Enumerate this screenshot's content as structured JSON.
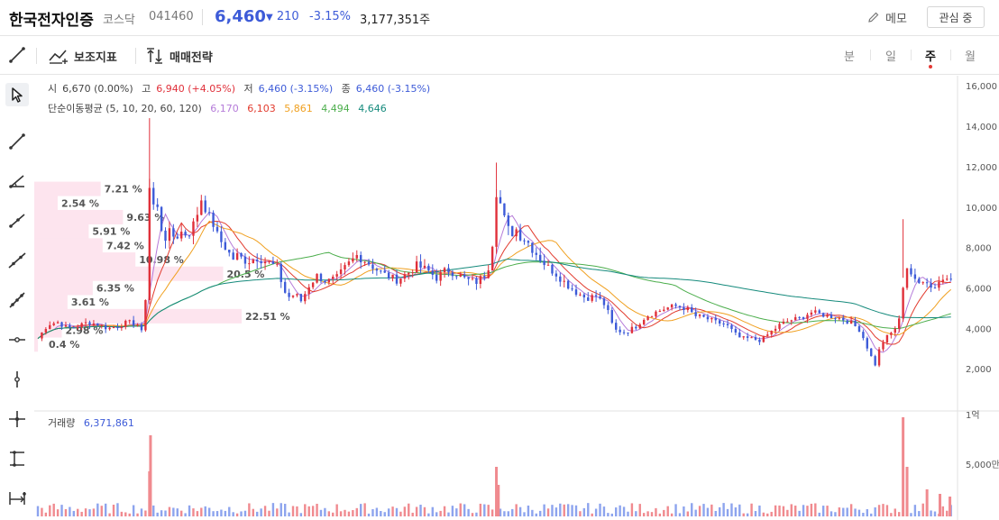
{
  "header": {
    "stock_name": "한국전자인증",
    "market": "코스닥",
    "code": "041460",
    "price": "6,460",
    "change": "210",
    "change_rate": "-3.15%",
    "volume": "3,177,351주",
    "memo_label": "메모",
    "favorite_label": "관심 중"
  },
  "toolbar": {
    "indicator_label": "보조지표",
    "strategy_label": "매매전략",
    "periods": [
      "분",
      "일",
      "주",
      "월"
    ],
    "active_period": "주"
  },
  "left_tools": [
    "cursor-icon",
    "line-icon",
    "angle-line-icon",
    "ray-icon",
    "extended-line-icon",
    "arrow-line-icon",
    "multi-point-line-icon",
    "horizontal-line-icon",
    "vertical-line-icon",
    "crosshair-line-icon",
    "fibonacci-icon",
    "measure-icon"
  ],
  "price_legend": {
    "open_label": "시",
    "open_value": "6,670 (0.00%)",
    "high_label": "고",
    "high_value": "6,940 (+4.05%)",
    "low_label": "저",
    "low_value": "6,460 (-3.15%)",
    "close_label": "종",
    "close_value": "6,460 (-3.15%)"
  },
  "ma_legend": {
    "label": "단순이동평균 (5, 10, 20, 60, 120)",
    "values": [
      "6,170",
      "6,103",
      "5,861",
      "4,494",
      "4,646"
    ],
    "colors": [
      "#b57bd9",
      "#e23b2e",
      "#f0a020",
      "#4cae4c",
      "#158a7c"
    ]
  },
  "volume_legend": {
    "label": "거래량",
    "value": "6,371,861"
  },
  "colors": {
    "up": "#e0303a",
    "down": "#3d5bd8",
    "accent": "#3d5bd8",
    "profile": "#fde4ee"
  },
  "chart_data": {
    "type": "candlestick",
    "y_axis_ticks": [
      "2,000",
      "4,000",
      "6,000",
      "8,000",
      "10,000",
      "12,000",
      "14,000",
      "16,000"
    ],
    "ylim": [
      0,
      16500
    ],
    "volume_axis_ticks": [
      "5,000만",
      "1억"
    ],
    "volume_profile": [
      {
        "price": 3200,
        "pct": "0.4 %",
        "share": 0.004
      },
      {
        "price": 3900,
        "pct": "2.98 %",
        "share": 0.0298
      },
      {
        "price": 4600,
        "pct": "22.51 %",
        "share": 0.2251
      },
      {
        "price": 5300,
        "pct": "3.61 %",
        "share": 0.0361
      },
      {
        "price": 6000,
        "pct": "6.35 %",
        "share": 0.0635
      },
      {
        "price": 6700,
        "pct": "20.5 %",
        "share": 0.205
      },
      {
        "price": 7400,
        "pct": "10.98 %",
        "share": 0.1098
      },
      {
        "price": 8100,
        "pct": "7.42 %",
        "share": 0.0742
      },
      {
        "price": 8800,
        "pct": "5.91 %",
        "share": 0.0591
      },
      {
        "price": 9500,
        "pct": "9.63 %",
        "share": 0.0963
      },
      {
        "price": 10200,
        "pct": "2.54 %",
        "share": 0.0254
      },
      {
        "price": 10900,
        "pct": "7.21 %",
        "share": 0.0721
      }
    ],
    "close_path": [
      [
        0,
        3500
      ],
      [
        10,
        4200
      ],
      [
        20,
        4300
      ],
      [
        30,
        4000
      ],
      [
        40,
        4100
      ],
      [
        50,
        4300
      ],
      [
        60,
        4200
      ],
      [
        70,
        4000
      ],
      [
        80,
        4100
      ],
      [
        90,
        4300
      ],
      [
        100,
        4200
      ],
      [
        105,
        3700
      ],
      [
        108,
        5500
      ],
      [
        112,
        11000
      ],
      [
        115,
        10000
      ],
      [
        118,
        10300
      ],
      [
        122,
        9500
      ],
      [
        126,
        8400
      ],
      [
        132,
        8700
      ],
      [
        138,
        8500
      ],
      [
        145,
        8800
      ],
      [
        150,
        8600
      ],
      [
        155,
        9000
      ],
      [
        160,
        9700
      ],
      [
        165,
        10600
      ],
      [
        170,
        9600
      ],
      [
        175,
        9300
      ],
      [
        180,
        8600
      ],
      [
        185,
        8200
      ],
      [
        190,
        7900
      ],
      [
        195,
        7400
      ],
      [
        200,
        7600
      ],
      [
        210,
        7300
      ],
      [
        220,
        7500
      ],
      [
        230,
        7300
      ],
      [
        240,
        7000
      ],
      [
        245,
        6200
      ],
      [
        250,
        5500
      ],
      [
        258,
        5700
      ],
      [
        265,
        5300
      ],
      [
        270,
        6000
      ],
      [
        280,
        6600
      ],
      [
        290,
        6300
      ],
      [
        300,
        6500
      ],
      [
        310,
        7100
      ],
      [
        320,
        7600
      ],
      [
        330,
        7300
      ],
      [
        340,
        6900
      ],
      [
        350,
        6600
      ],
      [
        360,
        6400
      ],
      [
        370,
        6700
      ],
      [
        380,
        7100
      ],
      [
        390,
        6900
      ],
      [
        400,
        6500
      ],
      [
        410,
        6900
      ],
      [
        420,
        6700
      ],
      [
        430,
        6400
      ],
      [
        440,
        6300
      ],
      [
        450,
        6700
      ],
      [
        455,
        7600
      ],
      [
        460,
        10800
      ],
      [
        465,
        10000
      ],
      [
        470,
        9000
      ],
      [
        475,
        8700
      ],
      [
        480,
        8900
      ],
      [
        485,
        8500
      ],
      [
        490,
        8400
      ],
      [
        495,
        8000
      ],
      [
        500,
        7700
      ],
      [
        505,
        7400
      ],
      [
        510,
        7100
      ],
      [
        520,
        6700
      ],
      [
        530,
        6200
      ],
      [
        540,
        5800
      ],
      [
        550,
        5500
      ],
      [
        560,
        5600
      ],
      [
        570,
        5100
      ],
      [
        575,
        4300
      ],
      [
        580,
        3900
      ],
      [
        590,
        3800
      ],
      [
        600,
        4100
      ],
      [
        610,
        4600
      ],
      [
        620,
        4800
      ],
      [
        630,
        5000
      ],
      [
        640,
        5100
      ],
      [
        650,
        5000
      ],
      [
        660,
        4600
      ],
      [
        670,
        4500
      ],
      [
        680,
        4300
      ],
      [
        690,
        4200
      ],
      [
        700,
        3700
      ],
      [
        705,
        3500
      ],
      [
        715,
        3500
      ],
      [
        725,
        3400
      ],
      [
        735,
        3800
      ],
      [
        745,
        4200
      ],
      [
        755,
        4400
      ],
      [
        765,
        4500
      ],
      [
        775,
        4800
      ],
      [
        785,
        4700
      ],
      [
        795,
        4600
      ],
      [
        805,
        4500
      ],
      [
        815,
        4300
      ],
      [
        825,
        3900
      ],
      [
        830,
        3300
      ],
      [
        835,
        2700
      ],
      [
        840,
        2200
      ],
      [
        845,
        3100
      ],
      [
        850,
        3500
      ],
      [
        855,
        3700
      ],
      [
        860,
        4000
      ],
      [
        865,
        4500
      ],
      [
        870,
        7200
      ],
      [
        875,
        6800
      ],
      [
        880,
        6300
      ],
      [
        885,
        6200
      ],
      [
        890,
        6600
      ],
      [
        895,
        6000
      ],
      [
        900,
        6100
      ],
      [
        905,
        6400
      ],
      [
        910,
        6400
      ],
      [
        915,
        6700
      ],
      [
        918,
        6460
      ]
    ],
    "volume_bars": [
      {
        "i": 112,
        "v": 0.5
      },
      {
        "i": 113,
        "v": 0.9
      },
      {
        "i": 460,
        "v": 0.55
      },
      {
        "i": 462,
        "v": 0.35
      },
      {
        "i": 868,
        "v": 1.1
      },
      {
        "i": 872,
        "v": 0.55
      },
      {
        "i": 892,
        "v": 0.3
      },
      {
        "i": 905,
        "v": 0.25
      },
      {
        "i": 915,
        "v": 0.22
      }
    ]
  }
}
